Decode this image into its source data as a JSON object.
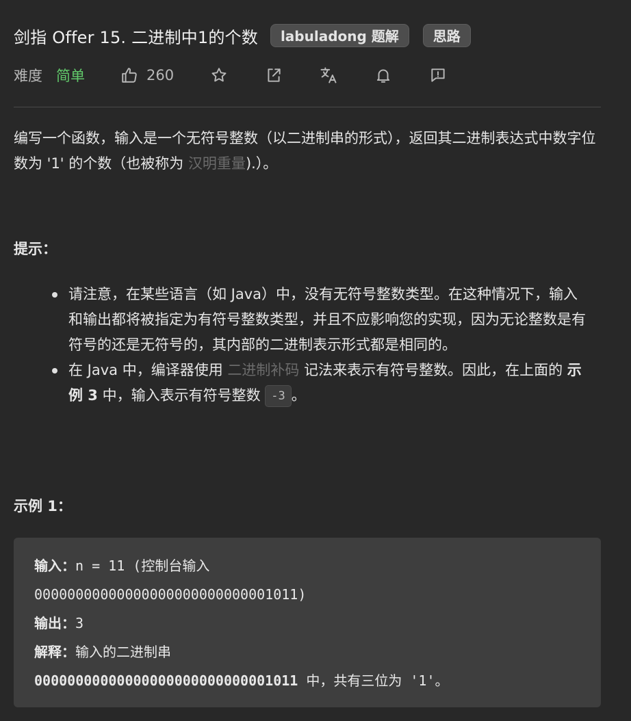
{
  "header": {
    "title": "剑指 Offer 15. 二进制中1的个数",
    "tags": [
      "labuladong 题解",
      "思路"
    ]
  },
  "meta": {
    "difficulty_label": "难度",
    "difficulty_value": "简单",
    "likes": "260",
    "icons": [
      "thumbs-up-icon",
      "star-icon",
      "share-icon",
      "translate-icon",
      "bell-icon",
      "feedback-icon"
    ]
  },
  "description": {
    "part1": "编写一个函数，输入是一个无符号整数（以二进制串的形式），返回其二进制表达式中数字位数为 '1' 的个数（也被称为 ",
    "link": "汉明重量",
    "part2": ").）。"
  },
  "hints": {
    "title": "提示：",
    "item1": "请注意，在某些语言（如 Java）中，没有无符号整数类型。在这种情况下，输入和输出都将被指定为有符号整数类型，并且不应影响您的实现，因为无论整数是有符号的还是无符号的，其内部的二进制表示形式都是相同的。",
    "item2_part1": "在 Java 中，编译器使用 ",
    "item2_link": "二进制补码",
    "item2_part2": " 记法来表示有符号整数。因此，在上面的 ",
    "item2_bold": "示例 3",
    "item2_part3": " 中，输入表示有符号整数 ",
    "item2_code": "-3",
    "item2_part4": "。"
  },
  "example1": {
    "title": "示例 1：",
    "input_label": "输入：",
    "input_value": "n = 11 (控制台输入",
    "input_binary": "00000000000000000000000000001011)",
    "output_label": "输出：",
    "output_value": "3",
    "explain_label": "解释：",
    "explain_value": "输入的二进制串",
    "explain_binary": "00000000000000000000000000001011",
    "explain_tail": " 中，共有三位为 '1'。"
  },
  "colors": {
    "background": "#282828",
    "difficulty_easy": "#61c96a",
    "muted_link": "#6b6b6b",
    "code_block": "#3e3e3e"
  }
}
